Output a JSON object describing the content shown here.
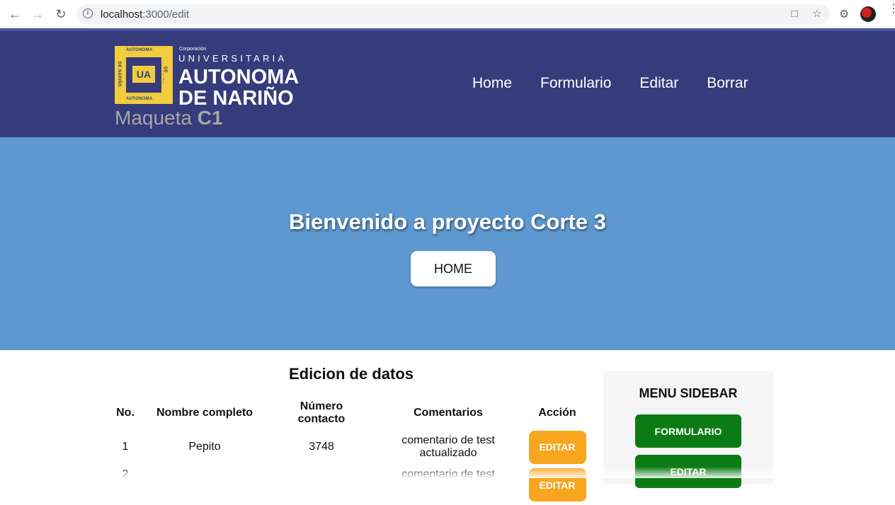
{
  "browser": {
    "url_host": "localhost",
    "url_path": ":3000/edit",
    "icons": [
      "back-icon",
      "forward-icon",
      "reload-icon",
      "info-icon",
      "translate-icon",
      "star-icon",
      "extensions-icon",
      "profile-avatar",
      "menu-icon"
    ]
  },
  "header": {
    "logo": {
      "badge_top": "AUTONOMA",
      "badge_bottom": "AUTONOMA",
      "badge_left": "DE NARIÑO",
      "badge_right": "DE NARIÑO",
      "monogram": "UA",
      "corp": "Corporación",
      "line1": "UNIVERSITARIA",
      "line2": "AUTONOMA",
      "line3": "DE NARIÑO"
    },
    "maqueta": "Maqueta",
    "maqueta_bold": "C1",
    "nav": [
      "Home",
      "Formulario",
      "Editar",
      "Borrar"
    ]
  },
  "hero": {
    "title": "Bienvenido a proyecto Corte 3",
    "button": "HOME"
  },
  "content": {
    "title": "Edicion de datos",
    "columns": [
      "No.",
      "Nombre completo",
      "Número contacto",
      "Comentarios",
      "Acción"
    ],
    "rows": [
      {
        "no": "1",
        "name": "Pepito",
        "number": "3748",
        "comment": "comentario de test actualizado",
        "action": "EDITAR"
      },
      {
        "no": "2",
        "name": "",
        "number": "",
        "comment": "comentario de test",
        "action": "EDITAR"
      }
    ]
  },
  "sidebar": {
    "title": "MENU SIDEBAR",
    "buttons": [
      "FORMULARIO",
      "EDITAR"
    ]
  },
  "colors": {
    "header_bg": "#353b7b",
    "hero_bg": "#5e98d0",
    "edit_button": "#f8a51f",
    "sidebar_button": "#0b7c14",
    "logo_yellow": "#f1cd3e"
  }
}
